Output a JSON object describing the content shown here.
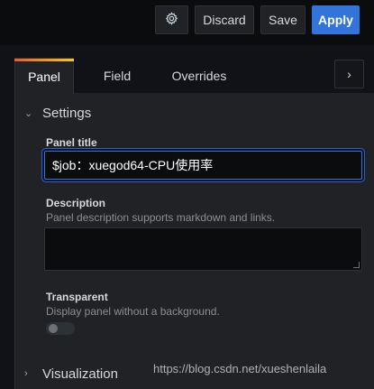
{
  "toolbar": {
    "settings_icon": "gear-icon",
    "discard_label": "Discard",
    "save_label": "Save",
    "apply_label": "Apply"
  },
  "tabs": [
    {
      "label": "Panel",
      "active": true
    },
    {
      "label": "Field",
      "active": false
    },
    {
      "label": "Overrides",
      "active": false
    }
  ],
  "tabs_next_icon": "chevron-right-icon",
  "settings": {
    "section_label": "Settings",
    "panel_title": {
      "label": "Panel title",
      "value": "$job：xuegod64-CPU使用率"
    },
    "description": {
      "label": "Description",
      "help": "Panel description supports markdown and links.",
      "value": ""
    },
    "transparent": {
      "label": "Transparent",
      "help": "Display panel without a background.",
      "enabled": false
    }
  },
  "visualization": {
    "section_label": "Visualization"
  },
  "watermark": "https://blog.csdn.net/xueshenlaila",
  "colors": {
    "accent": "#3274d9",
    "background": "#111217",
    "panel": "#202226",
    "input": "#0b0c0e"
  }
}
